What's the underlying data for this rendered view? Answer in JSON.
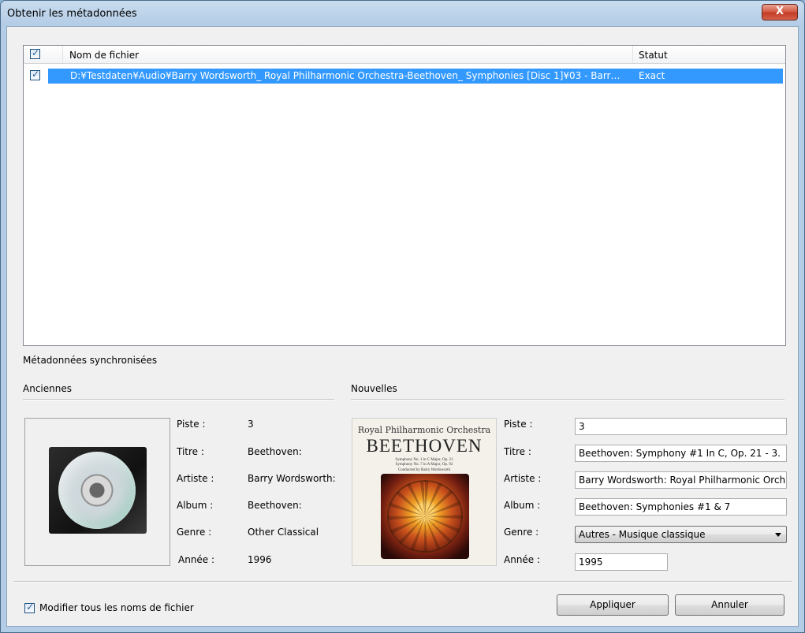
{
  "window": {
    "title": "Obtenir les métadonnées",
    "close_label": "X"
  },
  "list": {
    "columns": {
      "filename": "Nom de fichier",
      "status": "Statut"
    },
    "rows": [
      {
        "checked": true,
        "filename": "D:¥Testdaten¥Audio¥Barry Wordsworth_ Royal Philharmonic Orchestra-Beethoven_ Symphonies [Disc 1]¥03 - Barr…",
        "status": "Exact",
        "selected": true
      }
    ]
  },
  "sync": {
    "heading": "Métadonnées synchronisées",
    "old": {
      "heading": "Anciennes",
      "labels": {
        "track": "Piste :",
        "title": "Titre :",
        "artist": "Artiste :",
        "album": "Album :",
        "genre": "Genre :",
        "year": "Année :"
      },
      "values": {
        "track": "3",
        "title": "Beethoven:",
        "artist": "Barry Wordsworth:",
        "album": "Beethoven:",
        "genre": "Other Classical",
        "year": "1996"
      },
      "artwork_icon": "cd-case-icon"
    },
    "new": {
      "heading": "Nouvelles",
      "labels": {
        "track": "Piste :",
        "title": "Titre :",
        "artist": "Artiste :",
        "album": "Album :",
        "genre": "Genre :",
        "year": "Année :"
      },
      "values": {
        "track": "3",
        "title": "Beethoven: Symphony #1 In C, Op. 21 - 3.",
        "artist": "Barry Wordsworth: Royal Philharmonic Orch",
        "album": "Beethoven: Symphonies #1 & 7",
        "genre": "Autres - Musique classique",
        "year": "1995"
      },
      "cover": {
        "orchestra": "Royal Philharmonic Orchestra",
        "composer": "BEETHOVEN",
        "line1": "Symphony No. 1 in C Major, Op. 21",
        "line2": "Symphony No. 7 in A Major, Op. 92",
        "conductor": "Conducted by Barry Wordsworth"
      }
    }
  },
  "footer": {
    "rename_all_label": "Modifier tous les noms de fichier",
    "rename_all_checked": true,
    "apply_label": "Appliquer",
    "cancel_label": "Annuler"
  }
}
